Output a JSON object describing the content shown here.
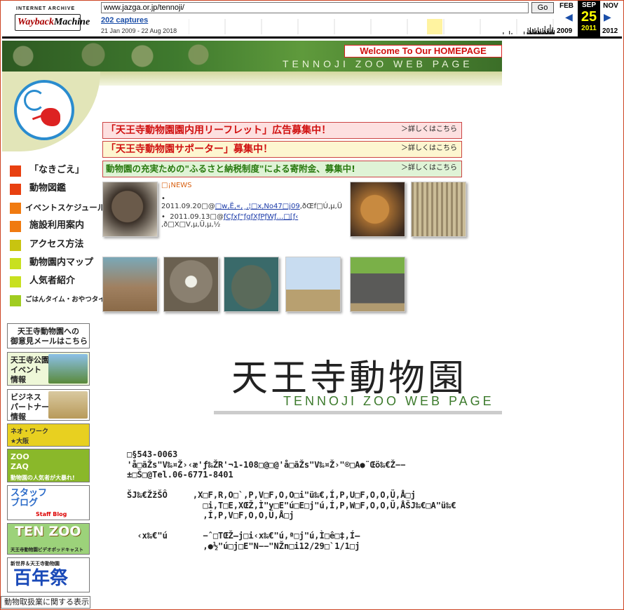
{
  "wayback": {
    "logo_top": "INTERNET ARCHIVE",
    "logo_a": "Wayback",
    "logo_b": "Machine",
    "url": "www.jazga.or.jp/tennoji/",
    "go_label": "Go",
    "captures": "202 captures",
    "range": "21 Jan 2009 - 22 Aug 2018",
    "prev_month": "FEB",
    "cur_month": "SEP",
    "cur_day": "25",
    "cur_year": "2011",
    "next_month": "NOV",
    "prev_year": "2009",
    "next_year": "2012"
  },
  "banner": {
    "welcome": "Welcome To Our HOMEPAGE",
    "subtitle": "TENNOJI ZOO WEB PAGE"
  },
  "nav": [
    {
      "label": "「なきごえ」",
      "color": "#e84010"
    },
    {
      "label": "動物図鑑",
      "color": "#e84010"
    },
    {
      "label": "イベントスケジュール",
      "color": "#f07a10"
    },
    {
      "label": "施設利用案内",
      "color": "#f07a10"
    },
    {
      "label": "アクセス方法",
      "color": "#c8c410"
    },
    {
      "label": "動物園内マップ",
      "color": "#c8e020"
    },
    {
      "label": "人気者紹介",
      "color": "#c8e020"
    },
    {
      "label": "ごはんタイム・おやつタイム",
      "color": "#a0cc20"
    }
  ],
  "side_buttons": {
    "mail": "天王寺動物園への\n御意見メールはこちら",
    "park": "天王寺公園\nイベント\n情報",
    "biz": "ビジネス\nパートナー\n情報",
    "osaka": "ネオ・ワーク\n★大阪",
    "zooz": "ZOO\nZAQ",
    "zooz_sub": "動物園の人気者が大暴れ!",
    "staff": "スタッフ\nブログ",
    "staff_sub": "Staff Blog",
    "tenzoo": "TEN ZOO",
    "tenzoo_sub": "天王寺動物園ビデオポッドキャスト",
    "hyaku_top": "新世界＆天王寺動物園",
    "hyaku": "百年祭",
    "law": "動物取扱業に関する表示"
  },
  "announcements": [
    {
      "text": "「天王寺動物園園内用リーフレット」広告募集中！",
      "more": "＞詳しくはこちら",
      "bg": "#fde0e0",
      "fg": "#d01010"
    },
    {
      "text": "「天王寺動物園サポーター」募集中！",
      "more": "＞詳しくはこちら",
      "bg": "#fdf6d0",
      "fg": "#d01010"
    },
    {
      "text": "動物園の充実ための\"ふるさと納税制度\"による寄附金、募集中!",
      "more": "＞詳しくはこちら",
      "bg": "#dff3d6",
      "fg": "#2a7a10"
    }
  ],
  "news": {
    "heading": "□¡NEWS",
    "item1_date": "2011.09.20□@",
    "item1_link": "□w‚Ë‚«‚¸‚¦□x‚No47□j09",
    "item1_tail": ",ðŒf□Ú‚µ‚Ü",
    "item2_date": "2011.09.13□@",
    "item2_link": "ƒCƒxƒ“ƒgƒXƒPƒWƒ…□[ƒ‹",
    "item2_tail": ",ð□X□V‚µ‚Ü‚µ‚½"
  },
  "main_title": "天王寺動物園",
  "main_subtitle": "TENNOJI ZOO WEB PAGE",
  "address": {
    "line1": "□§543-0063",
    "line2": "'å□ãŽs\"V‰¤Ž›‹æ'ƒ‰ŽR'¬1-108□@□@'å□ãŽs\"V‰¤Ž›\"®□A●¨Œö‰€Ž−−",
    "line3": "±□Š□@Tel.06-6771-8401",
    "line4": "ŠJ‰€ŽžŠÔ     ,X□F,R,O□`,P,V□F,O,O□i\"ü‰€,Í,P,U□F,O,O,Ü,Å□j",
    "line5": "               □i,T□E,XŒŽ,Ì\"y□E\"ú□E□j\"ú,Í,P,W□F,O,O,Ü,ÅŠJ‰€□A\"ü‰€",
    "line6": "               ,Í,P,V□F,O,O,Ü,Å□j",
    "line7": "  ‹x‰€\"ú       −ˆ□TŒŽ—j□i‹x‰€\"ú,ª□j\"ú,Ì□ê□‡,Í—",
    "line8": "               ,●½\"ú□j□E\"N−−\"NŽn□i12/29□`1/1□j"
  },
  "colors": {
    "accent_red": "#d01010",
    "link": "#1a4ea8",
    "zoo_green": "#3c7a2c"
  }
}
